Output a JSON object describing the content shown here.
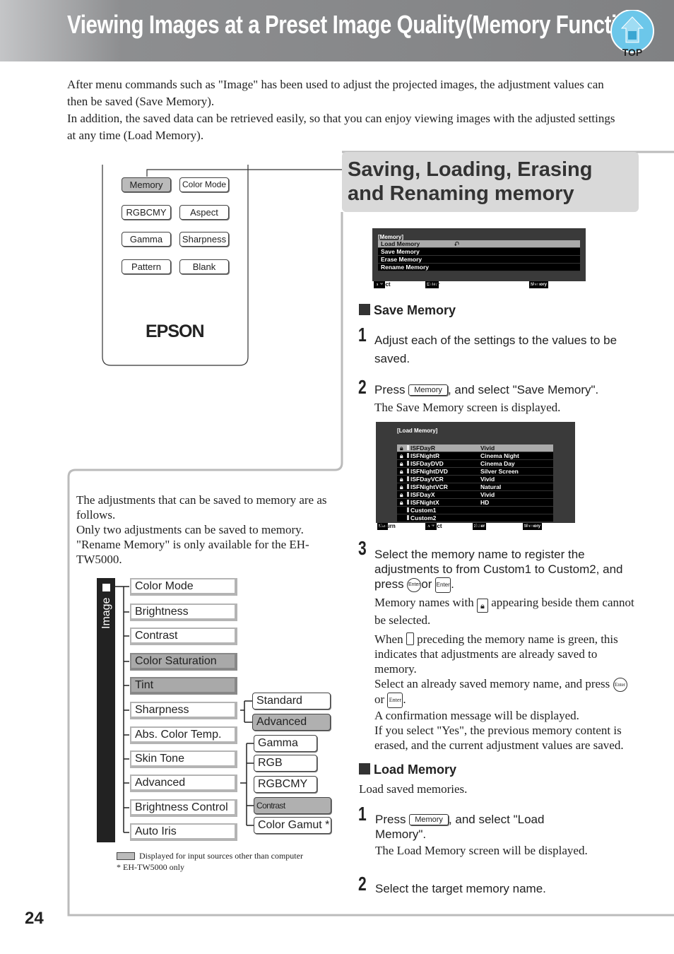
{
  "header": {
    "title": "Viewing Images at a Preset Image Quality(Memory Function)",
    "top_label": "TOP"
  },
  "intro": [
    "After menu commands such as \"Image\" has been used to adjust the projected images, the adjustment values can then be saved (Save Memory).",
    "In addition, the saved data can be retrieved easily, so that you can enjoy viewing images with the adjusted settings at any time (Load Memory)."
  ],
  "remote": {
    "buttons": [
      "Memory",
      "Color Mode",
      "RGBCMY",
      "Aspect",
      "Gamma",
      "Sharpness",
      "Pattern",
      "Blank"
    ],
    "logo": "EPSON"
  },
  "section": {
    "title": "Saving, Loading, Erasing and Renaming memory"
  },
  "memory_menu": {
    "title": "[Memory]",
    "items": [
      "Load Memory",
      "Save Memory",
      "Erase Memory",
      "Rename Memory"
    ],
    "footer": [
      {
        "key": "▲▼",
        "label": "Select"
      },
      {
        "key": "Enter",
        "label": "Enter"
      },
      {
        "key": "Memory",
        "label": "Exit"
      }
    ]
  },
  "save": {
    "heading": "Save Memory",
    "step1": "Adjust each of the settings to the values to be saved.",
    "step2_pre": "Press",
    "step2_key": "Memory",
    "step2_post": ", and select \"Save Memory\".",
    "step2_note": "The Save Memory screen is displayed.",
    "step3": "Select the memory name to register the adjustments to from Custom1 to Custom2, and press",
    "or": "or",
    "enter": "Enter",
    "note1_a": "Memory names with",
    "note1_b": "appearing beside them cannot be selected.",
    "note2_a": "When",
    "note2_b": "preceding the memory name is green, this indicates that adjustments are already saved to memory.",
    "note3": "Select an already saved memory name, and press",
    "note4": "A confirmation message will be displayed.",
    "note5": "If you select \"Yes\", the previous memory content is erased, and the current adjustment values are saved."
  },
  "load_menu": {
    "title": "[Load Memory]",
    "rows": [
      {
        "name": "ISFDayR",
        "mode": "Vivid",
        "locked": true
      },
      {
        "name": "ISFNightR",
        "mode": "Cinema Night",
        "locked": true
      },
      {
        "name": "ISFDayDVD",
        "mode": "Cinema Day",
        "locked": true
      },
      {
        "name": "ISFNightDVD",
        "mode": "Silver Screen",
        "locked": true
      },
      {
        "name": "ISFDayVCR",
        "mode": "Vivid",
        "locked": true
      },
      {
        "name": "ISFNightVCR",
        "mode": "Natural",
        "locked": true
      },
      {
        "name": "ISFDayX",
        "mode": "Vivid",
        "locked": true
      },
      {
        "name": "ISFNightX",
        "mode": "HD",
        "locked": true
      },
      {
        "name": "Custom1",
        "mode": "",
        "locked": false
      },
      {
        "name": "Custom2",
        "mode": "",
        "locked": false
      }
    ],
    "footer": [
      {
        "key": "Esc",
        "label": "Return"
      },
      {
        "key": "▲▼",
        "label": "Select"
      },
      {
        "key": "Enter",
        "label": "Set"
      },
      {
        "key": "Memory",
        "label": "Exit"
      }
    ]
  },
  "load": {
    "heading": "Load Memory",
    "intro": "Load saved memories.",
    "step1_pre": "Press",
    "step1_key": "Memory",
    "step1_post": ", and select \"Load Memory\".",
    "step1_note": "The Load Memory screen will be displayed.",
    "step2": "Select the target memory name."
  },
  "left_note": "The adjustments that can be saved to memory are as follows.\nOnly two adjustments can be saved to memory.\n\"Rename Memory\" is only available for the EH-TW5000.",
  "tree": {
    "root": "Image",
    "items": [
      {
        "label": "Color Mode",
        "gray": false
      },
      {
        "label": "Brightness",
        "gray": false
      },
      {
        "label": "Contrast",
        "gray": false
      },
      {
        "label": "Color Saturation",
        "gray": true
      },
      {
        "label": "Tint",
        "gray": true
      },
      {
        "label": "Sharpness",
        "gray": false
      },
      {
        "label": "Abs. Color Temp.",
        "gray": false
      },
      {
        "label": "Skin Tone",
        "gray": false
      },
      {
        "label": "Advanced",
        "gray": false
      },
      {
        "label": "Brightness Control",
        "gray": false
      },
      {
        "label": "Auto Iris",
        "gray": false
      }
    ],
    "sharpness_sub": [
      {
        "label": "Standard",
        "gray": false
      },
      {
        "label": "Advanced",
        "gray": true
      }
    ],
    "advanced_sub": [
      {
        "label": "Gamma",
        "gray": false
      },
      {
        "label": "RGB",
        "gray": false
      },
      {
        "label": "RGBCMY",
        "gray": false
      },
      {
        "label": "Contrast Enhancement *",
        "gray": true
      },
      {
        "label": "Color Gamut *",
        "gray": false
      }
    ]
  },
  "legend": {
    "gray": "Displayed for input sources other than computer",
    "asterisk": "* EH-TW5000 only"
  },
  "page_number": "24"
}
